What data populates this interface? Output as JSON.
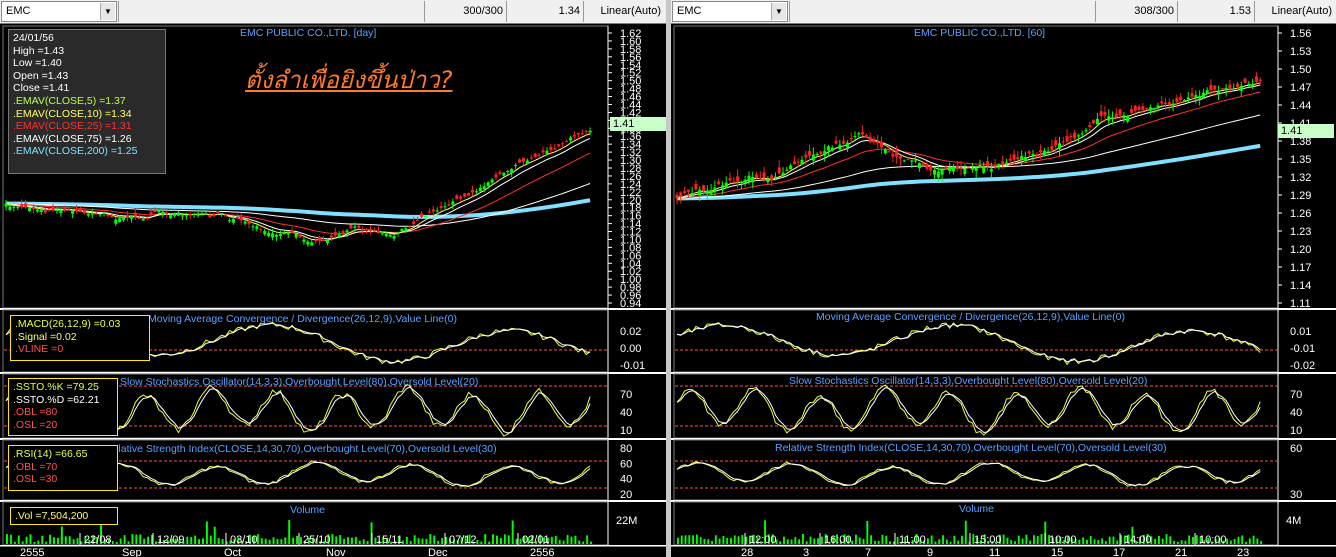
{
  "left": {
    "toolbar": {
      "symbol": "EMC",
      "count": "300/300",
      "value": "1.34",
      "scale": "Linear(Auto)"
    },
    "title": "EMC PUBLIC CO.,LTD. [day]",
    "annotation": "ตั้งลำเพื่อยิงขึ้นป่าว?",
    "price_tag": "1.41",
    "info": {
      "date": "24/01/56",
      "high": "High  =1.43",
      "low": "Low  =1.40",
      "open": "Open  =1.43",
      "close": "Close  =1.41",
      "ema5": ".EMAV(CLOSE,5)  =1.37",
      "ema10": ".EMAV(CLOSE,10)  =1.34",
      "ema25": ".EMAV(CLOSE,25)  =1.31",
      "ema75": ".EMAV(CLOSE,75)  =1.26",
      "ema200": ".EMAV(CLOSE,200)  =1.25"
    },
    "price_ticks": [
      "1.62",
      "1.60",
      "1.58",
      "1.56",
      "1.54",
      "1.52",
      "1.50",
      "1.48",
      "1.46",
      "1.44",
      "1.42",
      "1.40",
      "1.38",
      "1.36",
      "1.34",
      "1.32",
      "1.30",
      "1.28",
      "1.26",
      "1.24",
      "1.22",
      "1.20",
      "1.18",
      "1.16",
      "1.14",
      "1.12",
      "1.10",
      "1.08",
      "1.06",
      "1.04",
      "1.02",
      "1.00",
      "0.98",
      "0.96",
      "0.94"
    ],
    "macd": {
      "title": "Moving Average Convergence / Divergence(26,12,9),Value Line(0)",
      "macd": ".MACD(26,12,9)  =0.03",
      "signal": ".Signal  =0.02",
      "vline": ".VLINE  =0",
      "ticks": [
        "0.02",
        "0.00",
        "-0.01"
      ]
    },
    "sto": {
      "title": "Slow Stochastics Oscillator(14,3,3),Overbought Level(80),Oversold Level(20)",
      "k": ".SSTO.%K  =79.25",
      "d": ".SSTO.%D  =62.21",
      "obl": ".OBL  =80",
      "osl": ".OSL  =20",
      "ticks": [
        "70",
        "40",
        "10"
      ]
    },
    "rsi": {
      "title": "Relative Strength Index(CLOSE,14,30,70),Overbought Level(70),Oversold Level(30)",
      "rsi": ".RSI(14)  =66.65",
      "obl": ".OBL  =70",
      "osl": ".OSL  =30",
      "ticks": [
        "80",
        "60",
        "40",
        "20"
      ]
    },
    "vol": {
      "title": "Volume",
      "value": ".Vol  =7,504,200",
      "tick": "22M"
    },
    "xaxis": {
      "row1": [
        "22/08",
        "12/09",
        "03/10",
        "25/10",
        "15/11",
        "07/12",
        "02/01"
      ],
      "row2": [
        "2555",
        "Sep",
        "Oct",
        "Nov",
        "Dec",
        "2556"
      ]
    }
  },
  "right": {
    "toolbar": {
      "symbol": "EMC",
      "count": "308/300",
      "value": "1.53",
      "scale": "Linear(Auto)"
    },
    "title": "EMC PUBLIC CO.,LTD. [60]",
    "price_tag": "1.41",
    "price_ticks": [
      "1.56",
      "1.53",
      "1.50",
      "1.47",
      "1.44",
      "1.41",
      "1.38",
      "1.35",
      "1.32",
      "1.29",
      "1.26",
      "1.23",
      "1.20",
      "1.17",
      "1.14",
      "1.11"
    ],
    "macd": {
      "title": "Moving Average Convergence / Divergence(26,12,9),Value Line(0)",
      "ticks": [
        "0.01",
        "-0.01",
        "-0.02"
      ]
    },
    "sto": {
      "title": "Slow Stochastics Oscillator(14,3,3),Overbought Level(80),Oversold Level(20)",
      "ticks": [
        "70",
        "40",
        "10"
      ]
    },
    "rsi": {
      "title": "Relative Strength Index(CLOSE,14,30,70),Overbought Level(70),Oversold Level(30)",
      "ticks": [
        "60",
        "30"
      ]
    },
    "vol": {
      "title": "Volume",
      "tick": "4M"
    },
    "xaxis": {
      "row1": [
        "12:00",
        "16:00",
        "11:00",
        "15:00",
        "10:00",
        "14:00",
        "10:00"
      ],
      "row2": [
        "28",
        "3",
        "7",
        "9",
        "11",
        "15",
        "17",
        "21",
        "23"
      ]
    }
  },
  "colors": {
    "candle_up": "#00ff00",
    "candle_down": "#ff2020",
    "ema5": "#ffff66",
    "ema10": "#ffffff",
    "ema25": "#ff3030",
    "ema200": "#80e0ff",
    "osc1": "#e8ff40",
    "osc2": "#ffffff",
    "ref": "#ff5050",
    "label": "#5aa0ff"
  }
}
